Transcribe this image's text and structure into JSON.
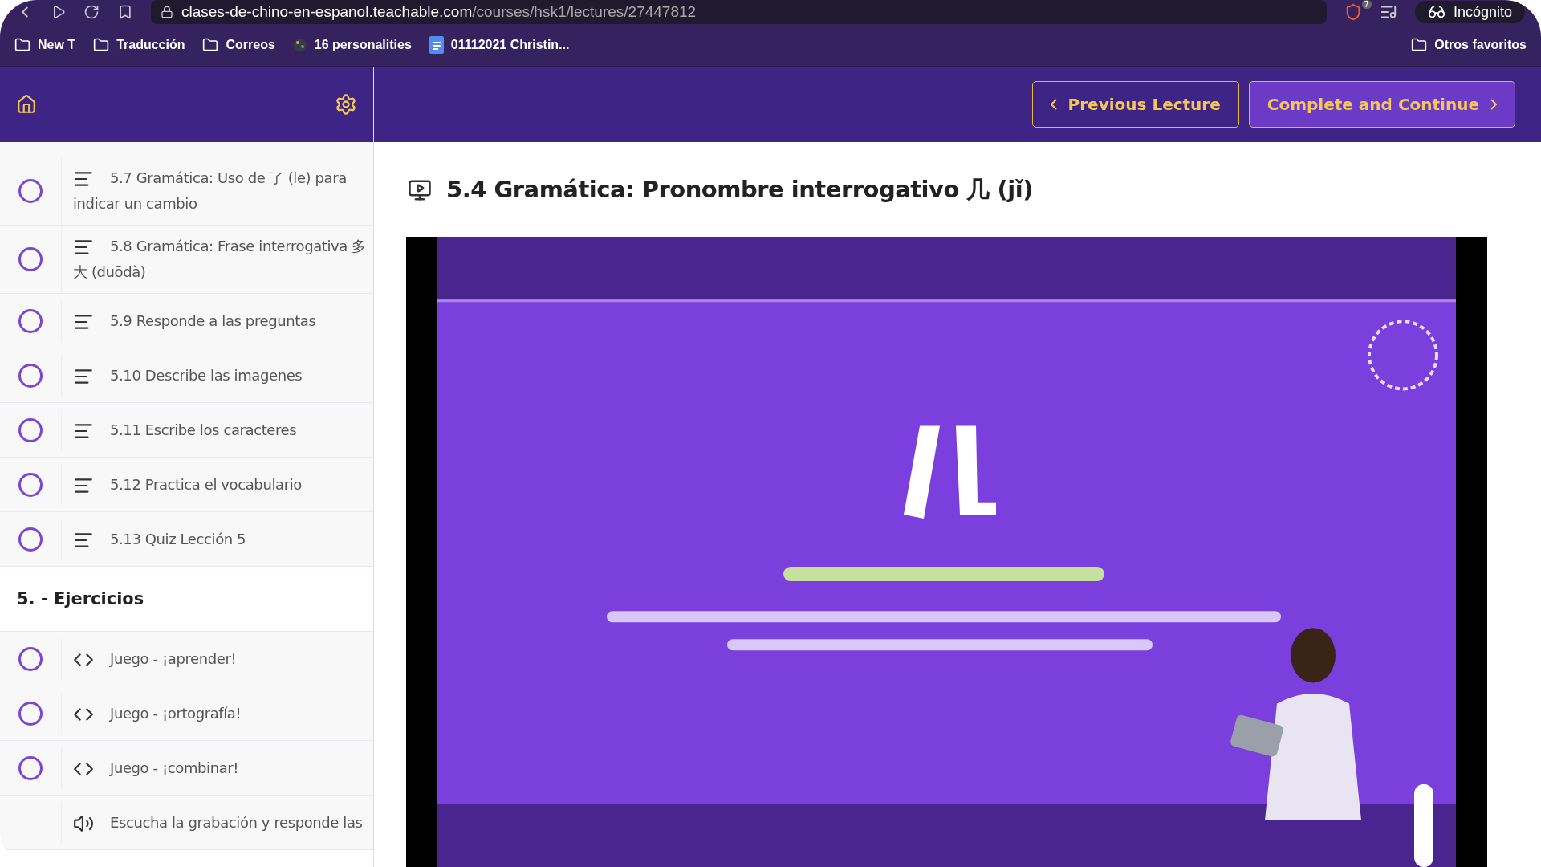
{
  "browser": {
    "url_domain": "clases-de-chino-en-espanol.teachable.com",
    "url_path": "/courses/hsk1/lectures/27447812",
    "shield_count": "7",
    "profile": "Incógnito",
    "bookmarks": [
      {
        "label": "New T",
        "kind": "folder"
      },
      {
        "label": "Traducción",
        "kind": "folder"
      },
      {
        "label": "Correos",
        "kind": "folder"
      },
      {
        "label": "16 personalities",
        "kind": "site"
      },
      {
        "label": "01112021 Christin...",
        "kind": "doc"
      }
    ],
    "other_bookmarks": "Otros favoritos"
  },
  "header": {
    "previous": "Previous Lecture",
    "next": "Complete and Continue"
  },
  "sidebar": {
    "sections": [
      {
        "items": [
          {
            "kind": "text",
            "title": "5.7 Gramática: Uso de 了 (le) para indicar un cambio",
            "completed": false
          },
          {
            "kind": "text",
            "title": "5.8 Gramática: Frase interrogativa 多大 (duōdà)",
            "completed": false
          },
          {
            "kind": "text",
            "title": "5.9 Responde a las preguntas",
            "completed": false
          },
          {
            "kind": "text",
            "title": "5.10 Describe las imagenes",
            "completed": false
          },
          {
            "kind": "text",
            "title": "5.11 Escribe los caracteres",
            "completed": false
          },
          {
            "kind": "text",
            "title": "5.12 Practica el vocabulario",
            "completed": false
          },
          {
            "kind": "text",
            "title": "5.13 Quiz Lección 5",
            "completed": false
          }
        ]
      },
      {
        "heading": "5. - Ejercicios",
        "items": [
          {
            "kind": "code",
            "title": "Juego - ¡aprender!",
            "completed": false
          },
          {
            "kind": "code",
            "title": "Juego - ¡ortografía!",
            "completed": false
          },
          {
            "kind": "code",
            "title": "Juego - ¡combinar!",
            "completed": false
          },
          {
            "kind": "audio",
            "title": "Escucha la grabación y responde las"
          }
        ]
      }
    ]
  },
  "lecture": {
    "title": "5.4 Gramática: Pronombre interrogativo 几 (jǐ)"
  }
}
